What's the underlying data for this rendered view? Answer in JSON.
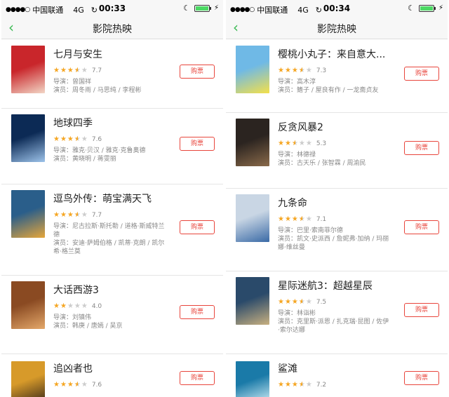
{
  "colors": {
    "accent": "#3cba54",
    "buy": "#e8453c",
    "star": "#f5a623"
  },
  "left": {
    "status": {
      "dots": "●●●●○",
      "carrier": "中国联通",
      "network": "4G",
      "time": "00:33"
    },
    "nav": {
      "back_icon": "‹",
      "title": "影院热映"
    },
    "movies": [
      {
        "title": "七月与安生",
        "score": "7.7",
        "stars": 3.5,
        "director": "导演：曾国祥",
        "cast": "演员：周冬雨 / 马思纯 / 李程彬",
        "cast2": "",
        "buy": "购票",
        "poster": [
          "#c9262b",
          "#f2d6c6"
        ]
      },
      {
        "title": "地球四季",
        "score": "7.6",
        "stars": 3.5,
        "director": "导演：雅克·贝汉 / 雅克·克鲁奥德",
        "cast": "演员：黄晓明 / 蒋雯丽",
        "cast2": "",
        "buy": "购票",
        "poster": [
          "#0c2a55",
          "#9dc3ea"
        ]
      },
      {
        "title": "逗鸟外传：萌宝满天飞",
        "score": "7.7",
        "stars": 3.5,
        "director": "导演：尼古拉斯·斯托勒 / 道格·斯威特兰",
        "director2": "德",
        "cast": "演员：安迪·萨姆伯格 / 凯蒂·克朗 / 凯尔",
        "cast2": "希·格兰莫",
        "buy": "购票",
        "poster": [
          "#2a5e8a",
          "#e6a63a"
        ]
      },
      {
        "title": "大话西游3",
        "score": "4.0",
        "stars": 2,
        "director": "导演：刘镇伟",
        "cast": "演员：韩庚 / 唐嫣 / 吴京",
        "cast2": "",
        "buy": "购票",
        "poster": [
          "#8a4a22",
          "#e4a86a"
        ]
      },
      {
        "title": "追凶者也",
        "score": "7.6",
        "stars": 3.5,
        "director": "",
        "cast": "",
        "cast2": "",
        "buy": "购票",
        "poster": [
          "#d79a2a",
          "#3a2a1a"
        ]
      }
    ]
  },
  "right": {
    "status": {
      "dots": "●●●●○",
      "carrier": "中国联通",
      "network": "4G",
      "time": "00:34"
    },
    "nav": {
      "back_icon": "‹",
      "title": "影院热映"
    },
    "movies": [
      {
        "title": "樱桃小丸子：来自意大...",
        "score": "7.3",
        "stars": 3.5,
        "director": "导演：高木淳",
        "cast": "演员：鳍子 / 屋良有作 / 一龙斋贞友",
        "cast2": "",
        "buy": "购票",
        "poster": [
          "#6fb9e6",
          "#f4e04a"
        ]
      },
      {
        "title": "反贪风暴2",
        "score": "5.3",
        "stars": 2.5,
        "director": "导演：林德禄",
        "cast": "演员：古天乐 / 张智霖 / 周渝民",
        "cast2": "",
        "buy": "购票",
        "poster": [
          "#2b2420",
          "#8a6a4a"
        ]
      },
      {
        "title": "九条命",
        "score": "7.1",
        "stars": 3.5,
        "director": "导演：巴里·索南菲尔德",
        "cast": "演员：凯文·史派西 / 詹妮弗·加纳 / 玛丽",
        "cast2": "娜·维丝曼",
        "buy": "购票",
        "poster": [
          "#c9d6e4",
          "#3a6aa6"
        ]
      },
      {
        "title": "星际迷航3：超越星辰",
        "score": "7.5",
        "stars": 3.5,
        "director": "导演：林诣彬",
        "cast": "演员：克里斯·派恩 / 扎克瑞·昆图 / 佐伊",
        "cast2": "·索尔达娜",
        "buy": "购票",
        "poster": [
          "#2a4a6a",
          "#c8b080"
        ]
      },
      {
        "title": "鲨滩",
        "score": "7.2",
        "stars": 3.5,
        "director": "",
        "cast": "",
        "cast2": "",
        "buy": "购票",
        "poster": [
          "#1a7aa8",
          "#d0eef6"
        ]
      }
    ]
  }
}
